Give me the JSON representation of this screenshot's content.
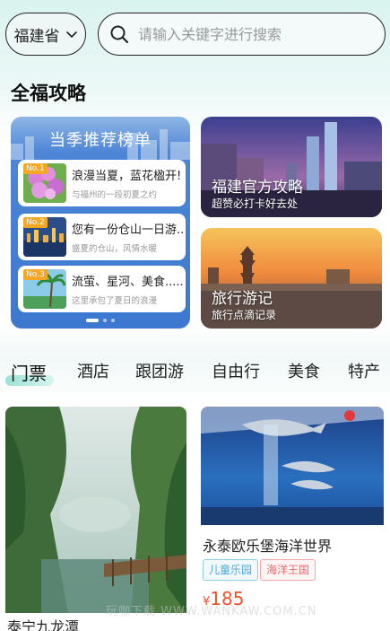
{
  "header": {
    "province": "福建省",
    "search_placeholder": "请输入关键字进行搜索"
  },
  "section_title": "全福攻略",
  "ranking": {
    "title": "当季推荐榜单",
    "items": [
      {
        "no": "No.1",
        "title": "浪漫当夏，蓝花楹开!",
        "subtitle": "与福州的一段初夏之约"
      },
      {
        "no": "No.2",
        "title": "您有一份仓山一日游...",
        "subtitle": "盛夏的仓山，风情水暖"
      },
      {
        "no": "No.3",
        "title": "流萤、星河、美食.......",
        "subtitle": "这里承包了夏日的浪漫"
      }
    ]
  },
  "promos": [
    {
      "title": "福建官方攻略",
      "subtitle": "超赞必打卡好去处"
    },
    {
      "title": "旅行游记",
      "subtitle": "旅行点滴记录"
    }
  ],
  "tabs": [
    "门票",
    "酒店",
    "跟团游",
    "自由行",
    "美食",
    "特产"
  ],
  "products": [
    {
      "name": "泰宁九龙潭"
    },
    {
      "name": "永泰欧乐堡海洋世界",
      "tags": [
        "儿童乐园",
        "海洋王国"
      ],
      "price_symbol": "¥",
      "price": "185"
    }
  ],
  "watermark": "玩咖下载 WWW.WANKAW.COM.CN",
  "colors": {
    "accent": "#f0522e",
    "tab_underline": "#8fe0cf",
    "ranking_bg": "#3c78cf"
  }
}
